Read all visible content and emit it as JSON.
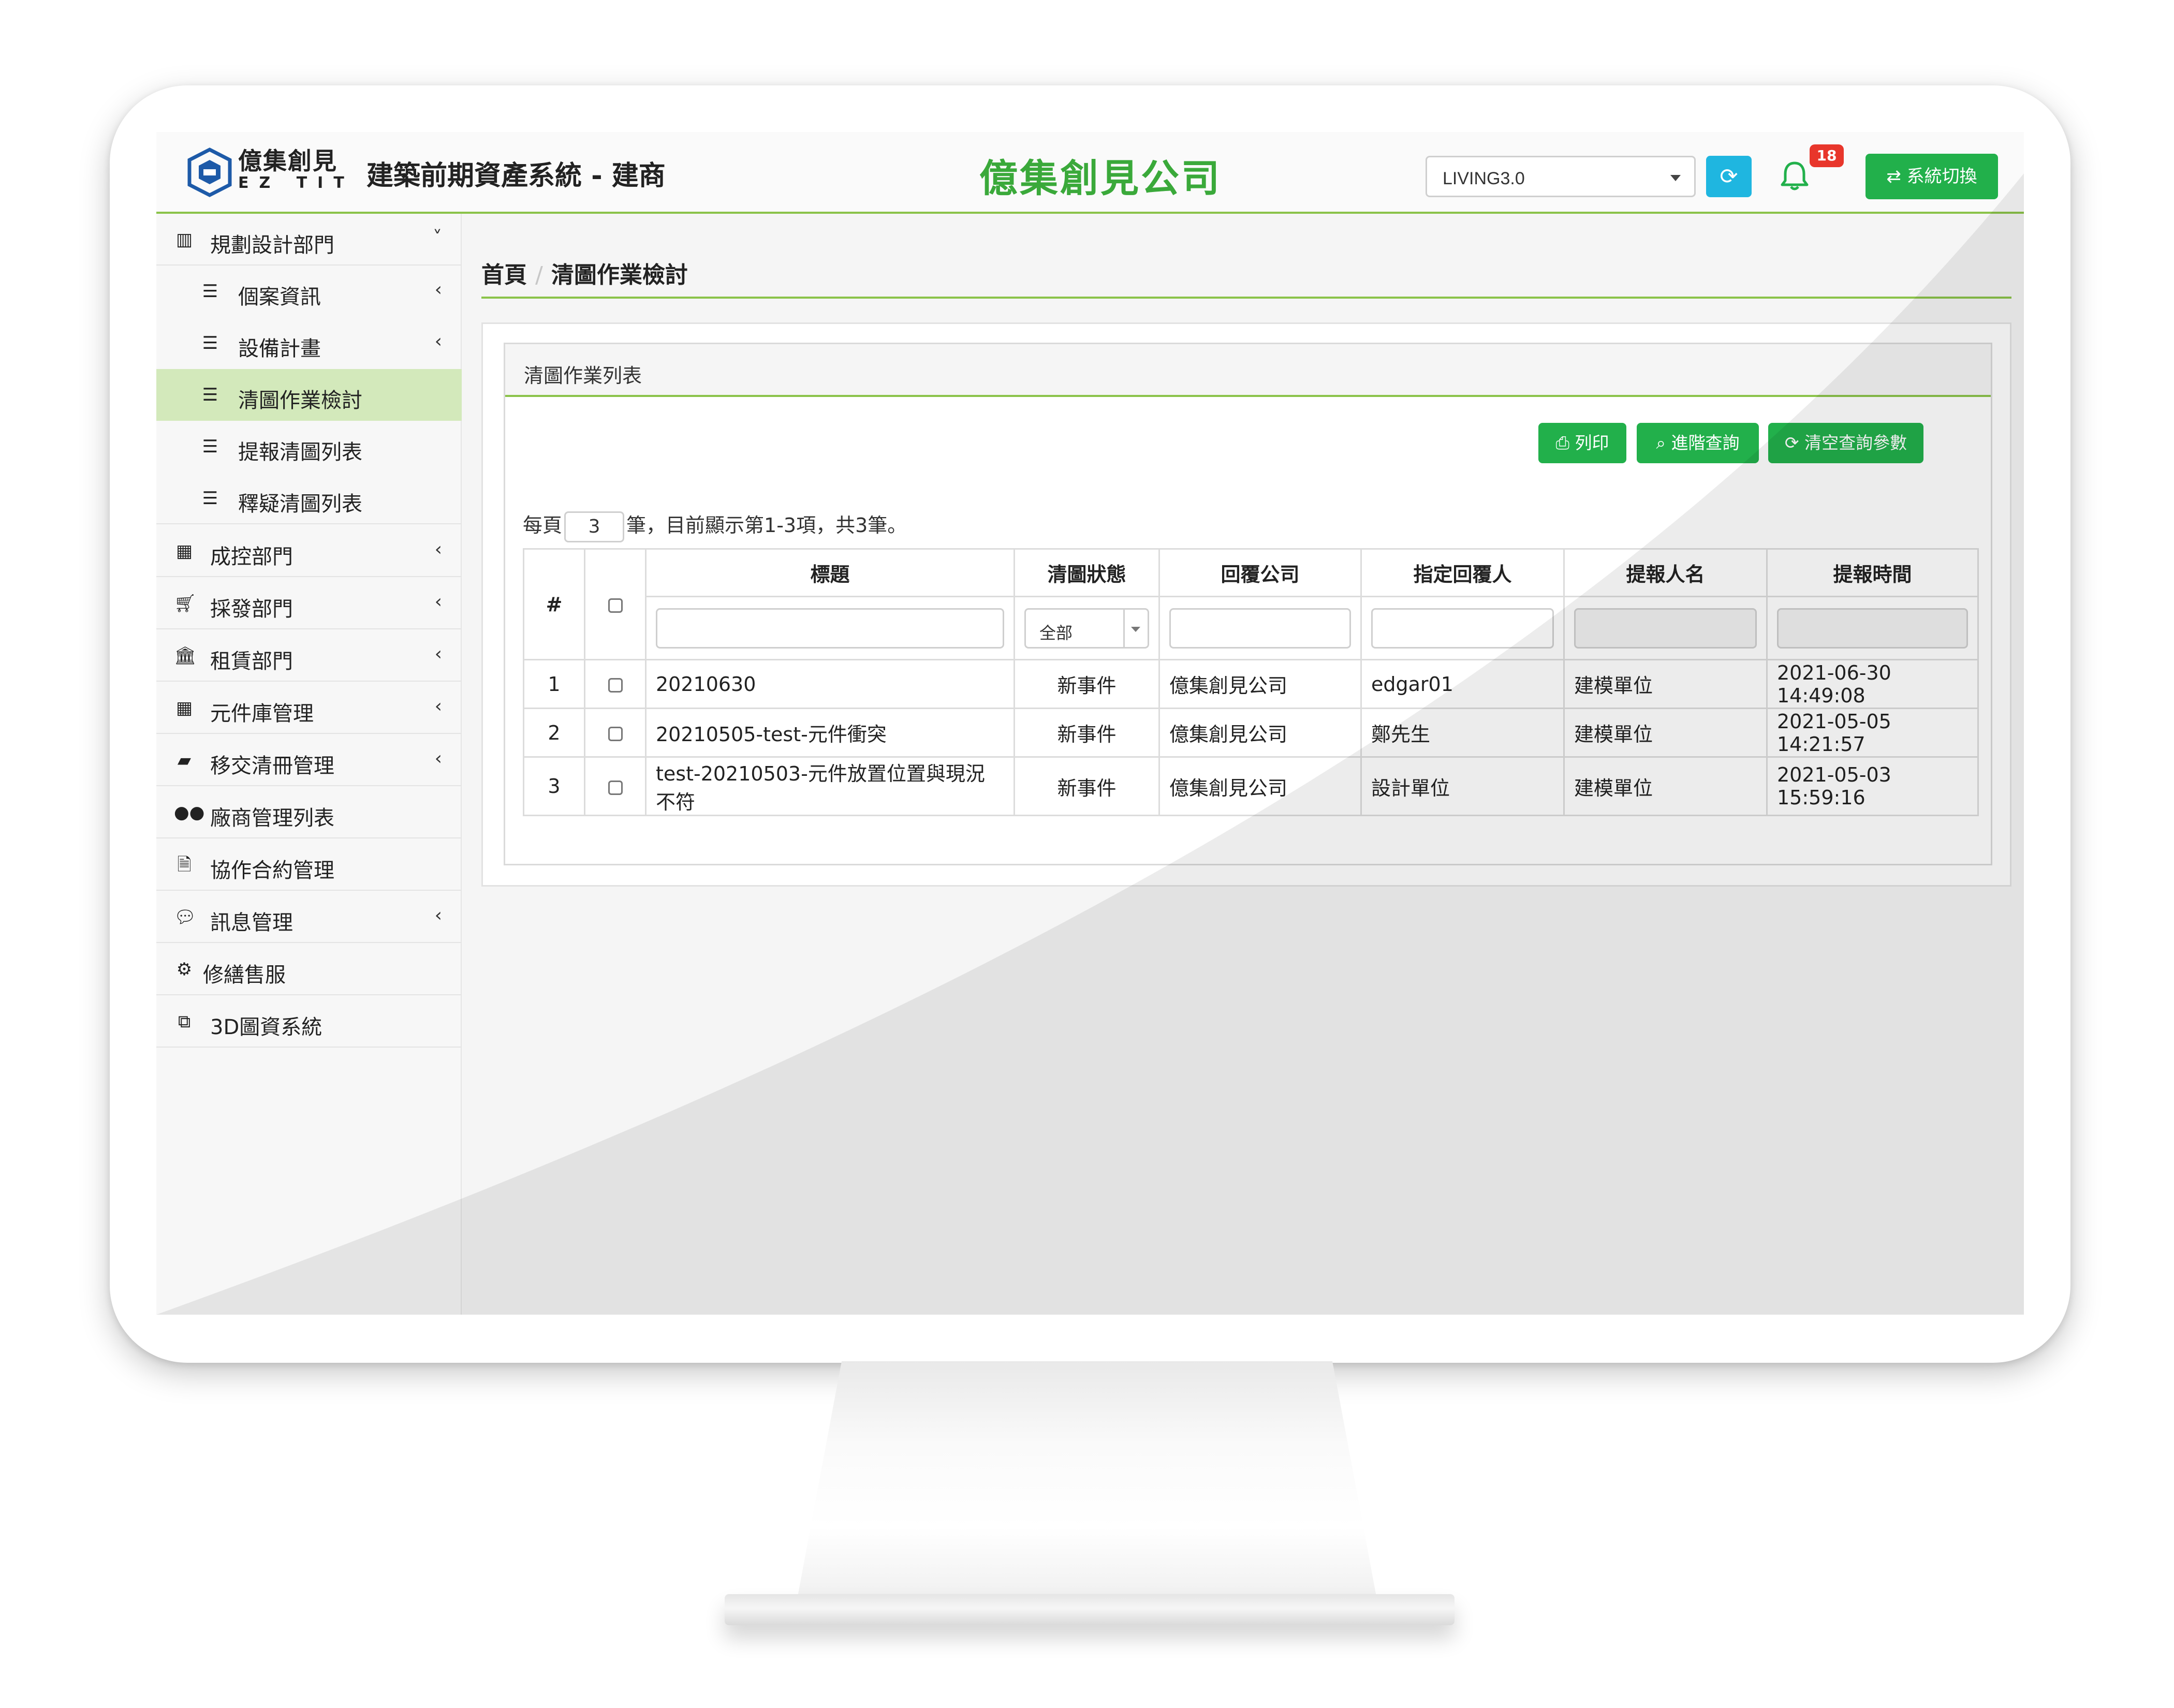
{
  "header": {
    "brand_name": "億集創見",
    "brand_sub": "EZ TIT",
    "system_title": "建築前期資產系統 - 建商",
    "company_name": "億集創見公司",
    "version_select": "LIVING3.0",
    "notification_count": "18",
    "switch_label": "系統切換",
    "accent_color": "#3aa93a"
  },
  "sidebar": {
    "items": [
      {
        "label": "規劃設計部門",
        "icon": "map-icon",
        "chevron": "˅"
      },
      {
        "label": "個案資訊",
        "icon": "list-icon",
        "chevron": "‹"
      },
      {
        "label": "設備計畫",
        "icon": "list-icon",
        "chevron": "‹"
      },
      {
        "label": "清圖作業檢討",
        "icon": "list-icon"
      },
      {
        "label": "提報清圖列表",
        "icon": "list-icon"
      },
      {
        "label": "釋疑清圖列表",
        "icon": "list-icon"
      },
      {
        "label": "成控部門",
        "icon": "calculator-icon",
        "chevron": "‹"
      },
      {
        "label": "採發部門",
        "icon": "cart-icon",
        "chevron": "‹"
      },
      {
        "label": "租賃部門",
        "icon": "bank-icon",
        "chevron": "‹"
      },
      {
        "label": "元件庫管理",
        "icon": "calculator-icon",
        "chevron": "‹"
      },
      {
        "label": "移交清冊管理",
        "icon": "book-icon",
        "chevron": "‹"
      },
      {
        "label": "廠商管理列表",
        "icon": "users-icon"
      },
      {
        "label": "協作合約管理",
        "icon": "document-icon"
      },
      {
        "label": "訊息管理",
        "icon": "comments-icon",
        "chevron": "‹"
      },
      {
        "label": "修繕售服",
        "icon": "gear-icon"
      },
      {
        "label": "3D圖資系統",
        "icon": "cubes-icon"
      }
    ]
  },
  "breadcrumb": {
    "home": "首頁",
    "current": "清圖作業檢討"
  },
  "panel": {
    "title": "清圖作業列表"
  },
  "toolbar": {
    "print": "列印",
    "advanced_search": "進階查詢",
    "clear_params": "清空查詢參數"
  },
  "pager": {
    "prefix": "每頁",
    "page_size": "3",
    "suffix": "筆，目前顯示第1-3項，共3筆。"
  },
  "table": {
    "headers": {
      "num": "#",
      "title": "標題",
      "status": "清圖狀態",
      "reply_company": "回覆公司",
      "assignee": "指定回覆人",
      "reporter": "提報人名",
      "report_time": "提報時間"
    },
    "status_filter": "全部",
    "rows": [
      {
        "num": "1",
        "title": "20210630",
        "status": "新事件",
        "reply_company": "億集創見公司",
        "assignee": "edgar01",
        "reporter": "建模單位",
        "report_time": "2021-06-30 14:49:08"
      },
      {
        "num": "2",
        "title": "20210505-test-元件衝突",
        "status": "新事件",
        "reply_company": "億集創見公司",
        "assignee": "鄭先生",
        "reporter": "建模單位",
        "report_time": "2021-05-05 14:21:57"
      },
      {
        "num": "3",
        "title": "test-20210503-元件放置位置與現況不符",
        "status": "新事件",
        "reply_company": "億集創見公司",
        "assignee": "設計單位",
        "reporter": "建模單位",
        "report_time": "2021-05-03 15:59:16"
      }
    ]
  },
  "colors": {
    "green": "#22b04b",
    "status_new": "#e8171c",
    "accent_line": "#8bc34a",
    "active_nav": "#d3e9bb"
  }
}
